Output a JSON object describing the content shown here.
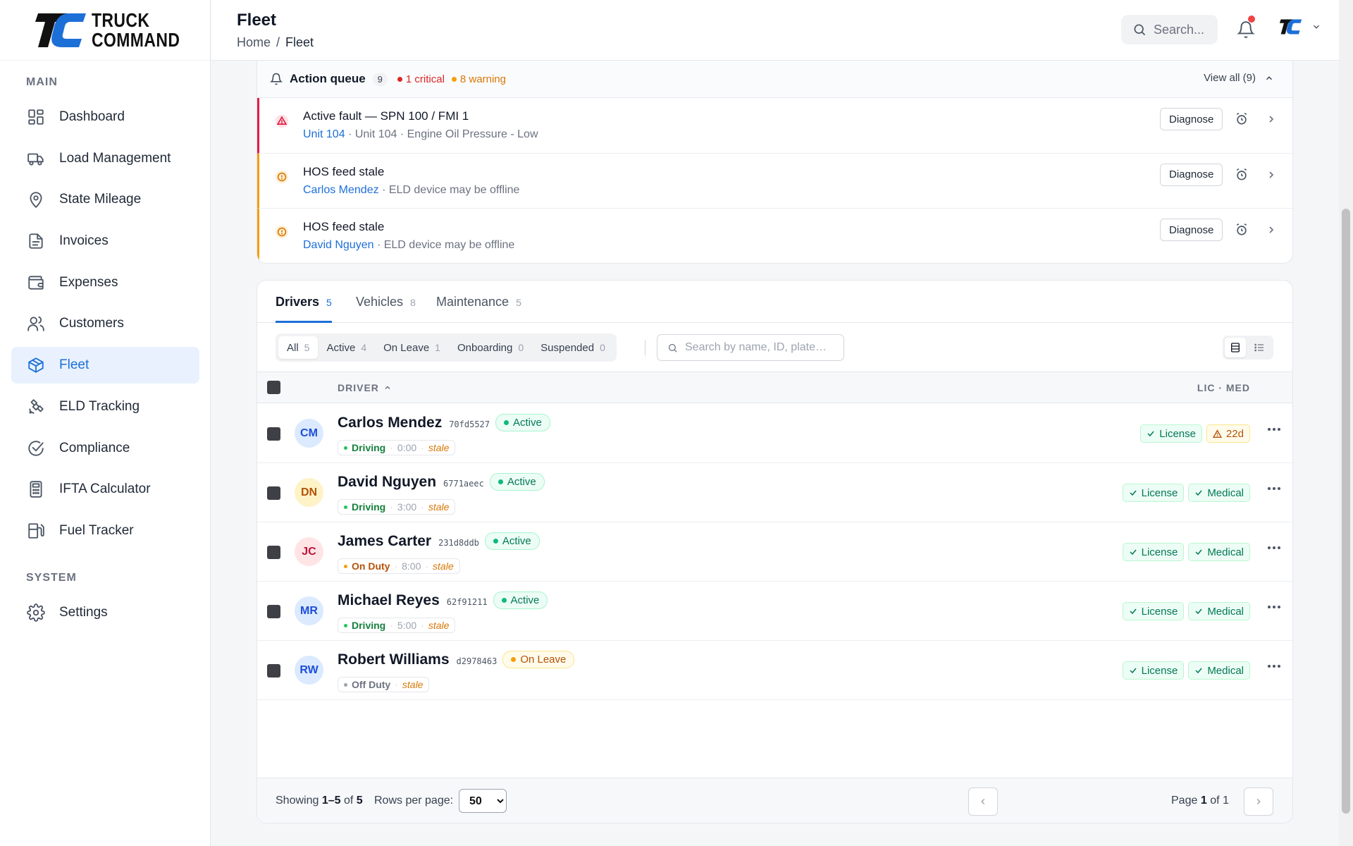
{
  "brand": {
    "line1": "TRUCK",
    "line2": "COMMAND"
  },
  "sidebar": {
    "main_label": "MAIN",
    "system_label": "SYSTEM",
    "items": [
      {
        "label": "Dashboard",
        "icon": "dashboard-icon"
      },
      {
        "label": "Load Management",
        "icon": "truck-icon"
      },
      {
        "label": "State Mileage",
        "icon": "map-pin-icon"
      },
      {
        "label": "Invoices",
        "icon": "file-icon"
      },
      {
        "label": "Expenses",
        "icon": "wallet-icon"
      },
      {
        "label": "Customers",
        "icon": "users-icon"
      },
      {
        "label": "Fleet",
        "icon": "box-icon",
        "active": true
      },
      {
        "label": "ELD Tracking",
        "icon": "satellite-icon"
      },
      {
        "label": "Compliance",
        "icon": "check-circle-icon"
      },
      {
        "label": "IFTA Calculator",
        "icon": "calculator-icon"
      },
      {
        "label": "Fuel Tracker",
        "icon": "fuel-icon"
      }
    ],
    "system_items": [
      {
        "label": "Settings",
        "icon": "gear-icon"
      }
    ]
  },
  "header": {
    "title": "Fleet",
    "breadcrumb": {
      "home": "Home",
      "sep": "/",
      "current": "Fleet"
    },
    "search_label": "Search..."
  },
  "queue": {
    "title": "Action queue",
    "count": "9",
    "critical": "1 critical",
    "warning": "8 warning",
    "view_all": "View all (9)",
    "items": [
      {
        "severity": "critical",
        "title": "Active fault — SPN 100 / FMI 1",
        "link": "Unit 104",
        "detail": "· Unit 104 · Engine Oil Pressure - Low",
        "action": "Diagnose"
      },
      {
        "severity": "warning",
        "title": "HOS feed stale",
        "link": "Carlos Mendez",
        "detail": "· ELD device may be offline",
        "action": "Diagnose"
      },
      {
        "severity": "warning",
        "title": "HOS feed stale",
        "link": "David Nguyen",
        "detail": "· ELD device may be offline",
        "action": "Diagnose"
      }
    ]
  },
  "tabs": [
    {
      "label": "Drivers",
      "count": "5",
      "active": true
    },
    {
      "label": "Vehicles",
      "count": "8"
    },
    {
      "label": "Maintenance",
      "count": "5"
    }
  ],
  "filters": [
    {
      "label": "All",
      "count": "5",
      "active": true
    },
    {
      "label": "Active",
      "count": "4"
    },
    {
      "label": "On Leave",
      "count": "1"
    },
    {
      "label": "Onboarding",
      "count": "0"
    },
    {
      "label": "Suspended",
      "count": "0"
    }
  ],
  "table_search_placeholder": "Search by name, ID, plate…",
  "columns": {
    "driver": "DRIVER",
    "licmed": "LIC · MED"
  },
  "drivers": [
    {
      "initials": "CM",
      "name": "Carlos Mendez",
      "id": "70fd5527",
      "status": "Active",
      "hos_status": "Driving",
      "hos_time": "0:00",
      "hos_note": "stale",
      "badges": [
        {
          "label": "License",
          "kind": "ok"
        },
        {
          "label": "22d",
          "kind": "warn"
        }
      ],
      "avatar_bg": "#dbeafe",
      "avatar_fg": "#1d4ed8"
    },
    {
      "initials": "DN",
      "name": "David Nguyen",
      "id": "6771aeec",
      "status": "Active",
      "hos_status": "Driving",
      "hos_time": "3:00",
      "hos_note": "stale",
      "badges": [
        {
          "label": "License",
          "kind": "ok"
        },
        {
          "label": "Medical",
          "kind": "ok"
        }
      ],
      "avatar_bg": "#fef3c7",
      "avatar_fg": "#b45309"
    },
    {
      "initials": "JC",
      "name": "James Carter",
      "id": "231d8ddb",
      "status": "Active",
      "hos_status": "On Duty",
      "hos_time": "8:00",
      "hos_note": "stale",
      "badges": [
        {
          "label": "License",
          "kind": "ok"
        },
        {
          "label": "Medical",
          "kind": "ok"
        }
      ],
      "avatar_bg": "#ffe4e6",
      "avatar_fg": "#be123c"
    },
    {
      "initials": "MR",
      "name": "Michael Reyes",
      "id": "62f91211",
      "status": "Active",
      "hos_status": "Driving",
      "hos_time": "5:00",
      "hos_note": "stale",
      "badges": [
        {
          "label": "License",
          "kind": "ok"
        },
        {
          "label": "Medical",
          "kind": "ok"
        }
      ],
      "avatar_bg": "#dbeafe",
      "avatar_fg": "#1d4ed8"
    },
    {
      "initials": "RW",
      "name": "Robert Williams",
      "id": "d2978463",
      "status": "On Leave",
      "hos_status": "Off Duty",
      "hos_time": "",
      "hos_note": "stale",
      "badges": [
        {
          "label": "License",
          "kind": "ok"
        },
        {
          "label": "Medical",
          "kind": "ok"
        }
      ],
      "avatar_bg": "#dbeafe",
      "avatar_fg": "#1d4ed8"
    }
  ],
  "footer": {
    "showing_prefix": "Showing",
    "range": "1–5",
    "of": "of",
    "total": "5",
    "rows_label": "Rows per page:",
    "rows_value": "50",
    "page_prefix": "Page",
    "page": "1",
    "page_of": "of 1"
  },
  "colors": {
    "accent": "#1d6fd8",
    "critical": "#e11d48",
    "warning": "#f59e0b",
    "active": "#10b981"
  }
}
